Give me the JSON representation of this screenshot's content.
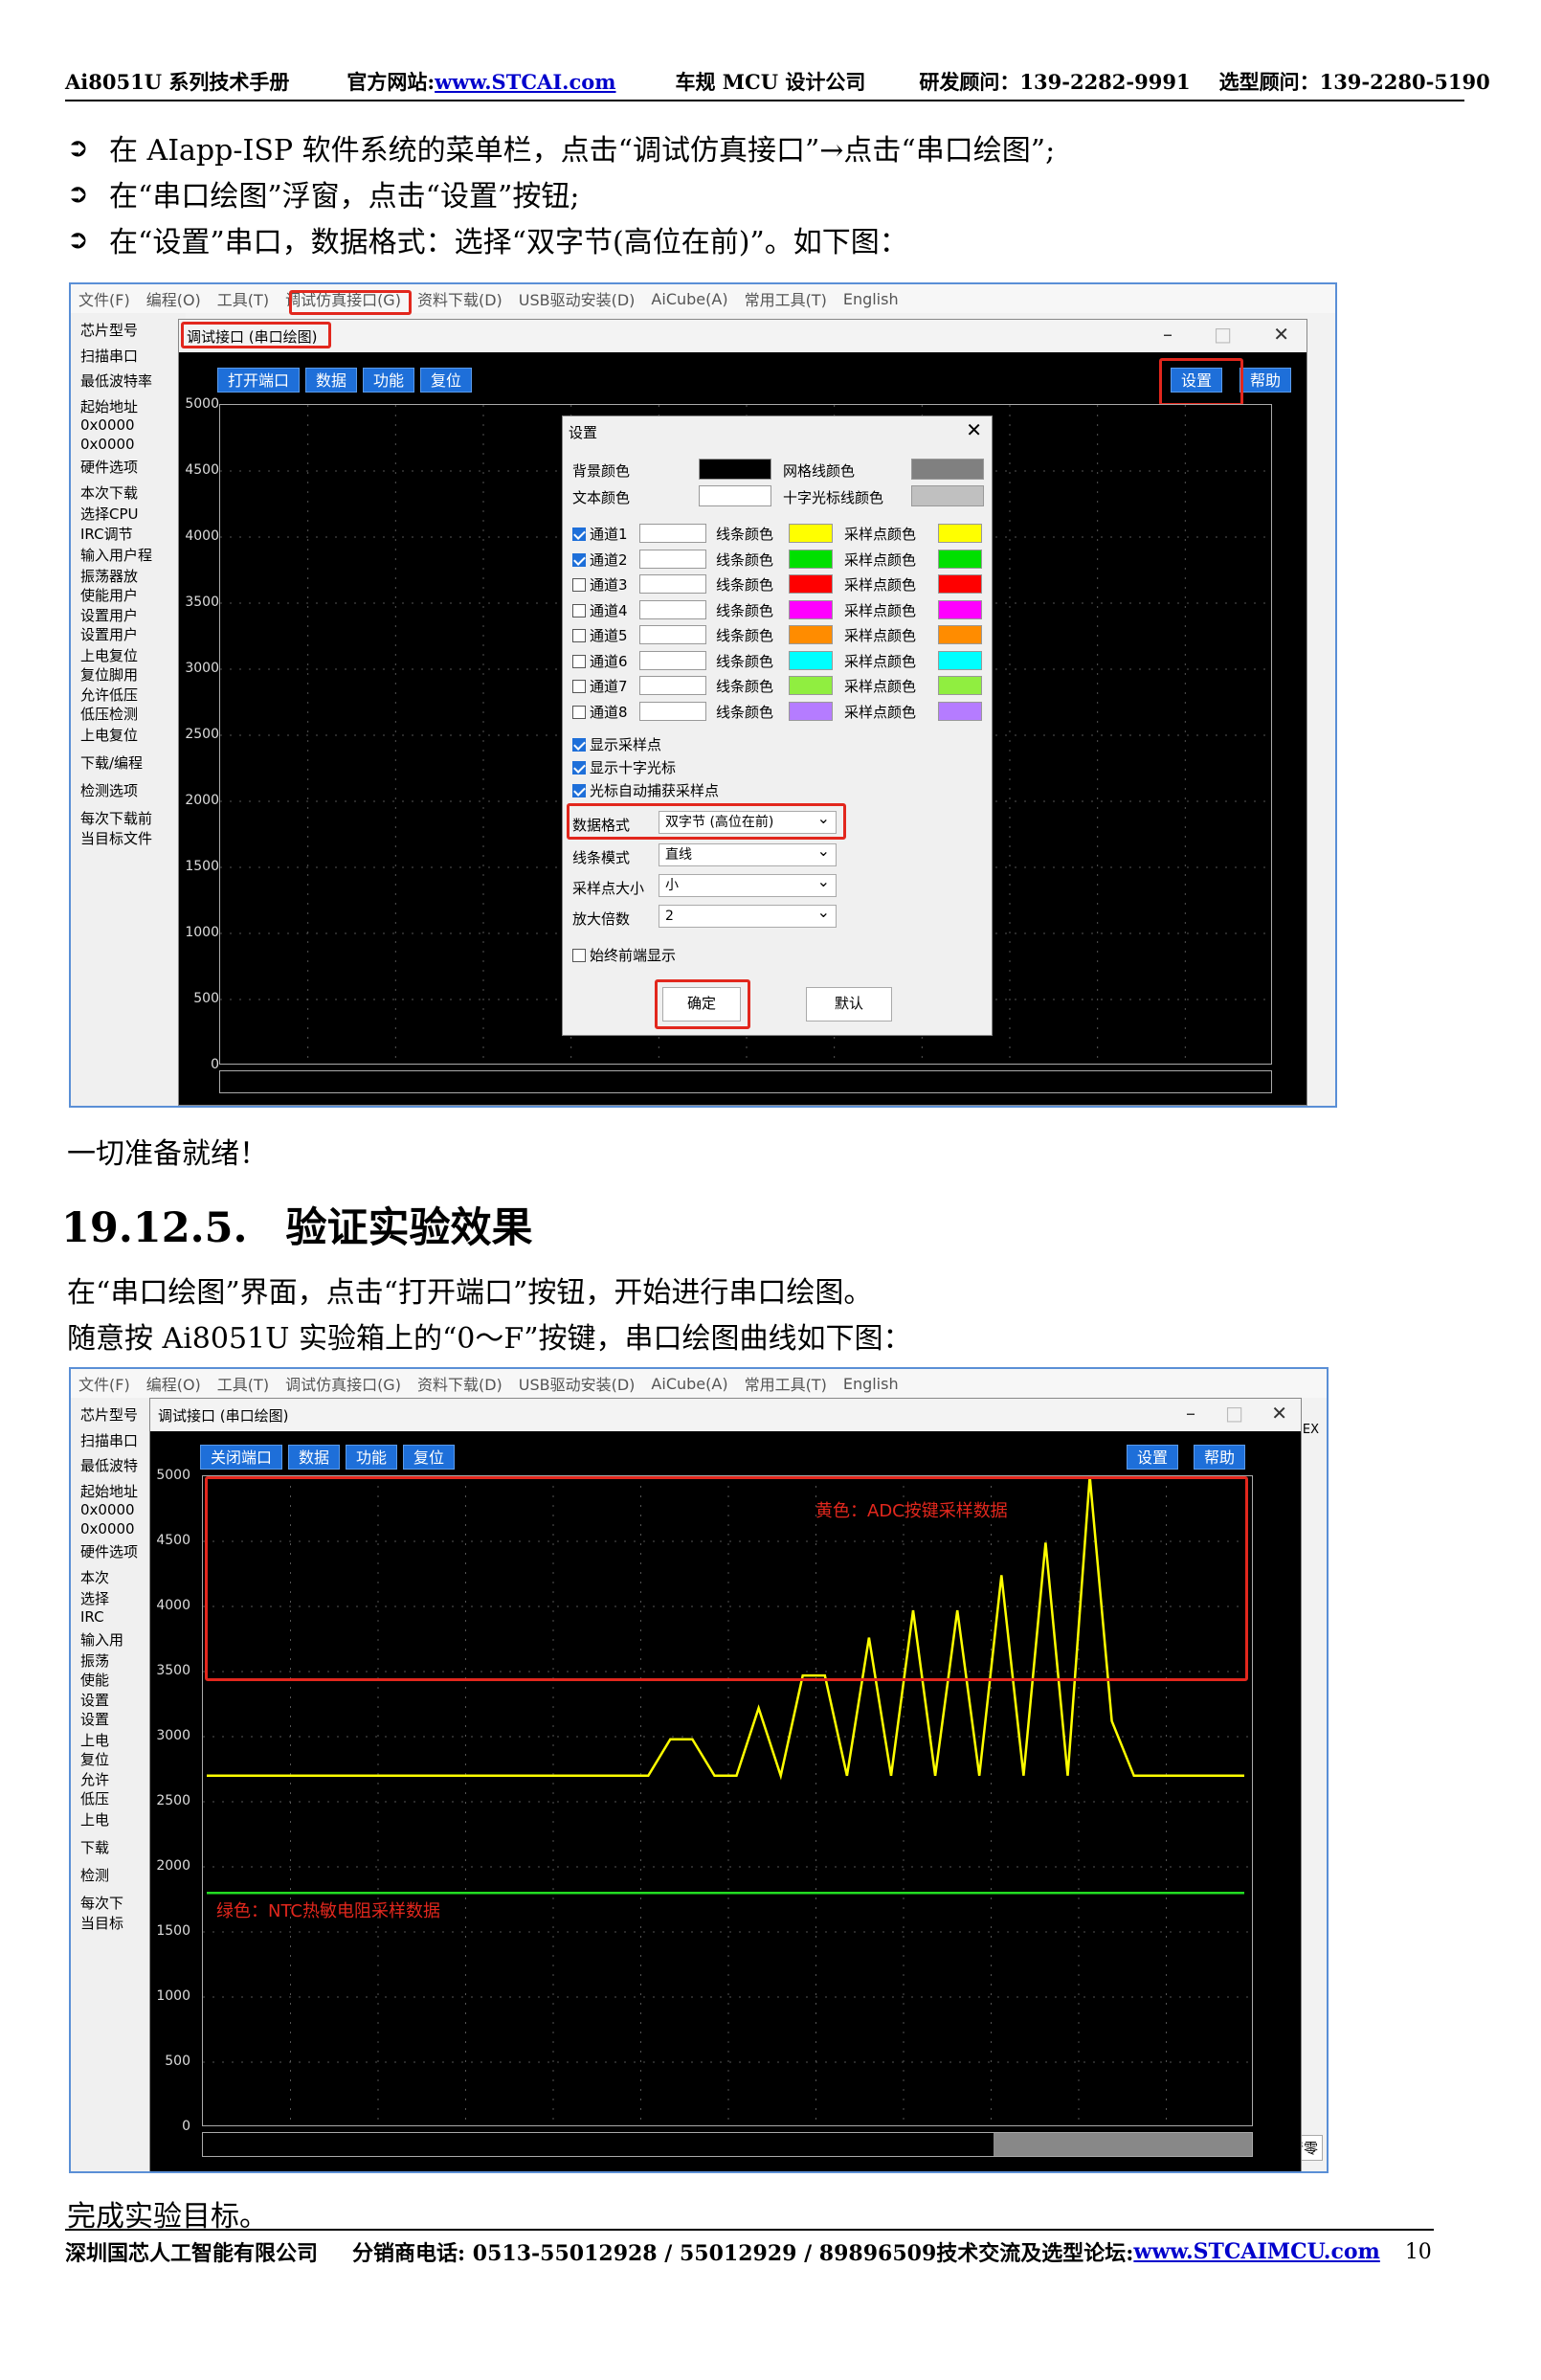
{
  "header": {
    "manual": "Ai8051U 系列技术手册",
    "site_label": "官方网站:",
    "site_url": "www.STCAI.com",
    "company": "车规 MCU 设计公司",
    "consult1": "研发顾问：139-2282-9991",
    "consult2": "选型顾问：139-2280-5190"
  },
  "bullets": [
    "在 AIapp-ISP 软件系统的菜单栏，点击“调试仿真接口”→点击“串口绘图”;",
    "在“串口绘图”浮窗，点击“设置”按钮;",
    "在“设置”串口，数据格式：选择“双字节(高位在前)”。如下图："
  ],
  "ready": "一切准备就绪！",
  "section": {
    "number": "19.12.5.",
    "title": "验证实验效果"
  },
  "para1": "在“串口绘图”界面，点击“打开端口”按钮，开始进行串口绘图。",
  "para2": "随意按 Ai8051U 实验箱上的“0～F”按键，串口绘图曲线如下图：",
  "done": "完成实验目标。",
  "footer": {
    "company": "深圳国芯人工智能有限公司",
    "phone": "分销商电话: 0513-55012928 / 55012929 / 89896509",
    "forum": "技术交流及选型论坛:",
    "forum_url": "www.STCAIMCU.com",
    "page": "10"
  },
  "menu": [
    "文件(F)",
    "编程(O)",
    "工具(T)",
    "调试仿真接口(G)",
    "资料下载(D)",
    "USB驱动安装(D)",
    "AiCube(A)",
    "常用工具(T)",
    "English"
  ],
  "left1": [
    "芯片型号",
    "扫描串口",
    "最低波特率",
    "起始地址",
    "0x0000",
    "0x0000",
    "硬件选项",
    "本次下载",
    "选择CPU",
    "IRC调节",
    "输入用户程",
    "振荡器放",
    "使能用户",
    "设置用户",
    "设置用户",
    "上电复位",
    "复位脚用",
    "允许低压",
    "低压检测",
    "上电复位",
    "下载/编程",
    "检测选项",
    "每次下载前",
    "当目标文件"
  ],
  "left2": [
    "芯片型号",
    "扫描串口",
    "最低波特",
    "起始地址",
    "0x0000",
    "0x0000",
    "硬件选项",
    "本次",
    "选择",
    "IRC",
    "输入用",
    "振荡",
    "使能",
    "设置",
    "设置",
    "上电",
    "复位",
    "允许",
    "低压",
    "上电",
    "下载",
    "检测",
    "每次下",
    "当目标"
  ],
  "win1": {
    "title": "调试接口 (串口绘图)",
    "buttons": [
      "打开端口",
      "数据",
      "功能",
      "复位"
    ],
    "settings": "设置",
    "help": "帮助"
  },
  "win2": {
    "title": "调试接口 (串口绘图)",
    "buttons": [
      "关闭端口",
      "数据",
      "功能",
      "复位"
    ],
    "settings": "设置",
    "help": "帮助",
    "clear": "清零",
    "hex": "EX"
  },
  "yticks": [
    "5000",
    "4500",
    "4000",
    "3500",
    "3000",
    "2500",
    "2000",
    "1500",
    "1000",
    "500",
    "0"
  ],
  "dialog": {
    "title": "设置",
    "bg": "背景颜色",
    "grid": "网格线颜色",
    "text": "文本颜色",
    "cross": "十字光标线颜色",
    "channels": [
      "通道1",
      "通道2",
      "通道3",
      "通道4",
      "通道5",
      "通道6",
      "通道7",
      "通道8"
    ],
    "line_color": "线条颜色",
    "sample_color": "采样点颜色",
    "channel_colors": [
      "#ffff00",
      "#00e000",
      "#ff0000",
      "#ff00ff",
      "#ff8c00",
      "#00ffff",
      "#90ee40",
      "#b57cff"
    ],
    "show_points": "显示采样点",
    "show_cross": "显示十字光标",
    "auto_capture": "光标自动捕获采样点",
    "format_label": "数据格式",
    "format_value": "双字节 (高位在前)",
    "line_mode_label": "线条模式",
    "line_mode_value": "直线",
    "point_size_label": "采样点大小",
    "point_size_value": "小",
    "zoom_label": "放大倍数",
    "zoom_value": "2",
    "front": "始终前端显示",
    "ok": "确定",
    "default": "默认"
  },
  "annotations": {
    "yellow": "黄色：ADC按键采样数据",
    "green": "绿色：NTC热敏电阻采样数据"
  },
  "chart_data": {
    "type": "line",
    "ylim": [
      0,
      5000
    ],
    "series": [
      {
        "name": "黄色：ADC按键采样数据",
        "color": "#ffff00",
        "x": [
          0,
          1,
          2,
          3,
          4,
          5,
          6,
          7,
          8,
          9,
          10,
          11,
          12,
          13,
          14,
          15,
          16,
          17,
          18,
          19,
          20,
          21,
          22,
          23,
          24,
          25,
          26,
          27,
          28,
          29,
          30,
          31,
          32,
          33,
          34,
          35,
          36,
          37,
          38,
          39,
          40,
          41,
          42,
          43,
          44,
          45,
          46,
          47
        ],
        "y": [
          2700,
          2700,
          2700,
          2700,
          2700,
          2700,
          2700,
          2700,
          2700,
          2700,
          2700,
          2700,
          2700,
          2700,
          2700,
          2700,
          2700,
          2700,
          2700,
          2700,
          2700,
          2980,
          2980,
          2700,
          2700,
          3220,
          2700,
          3470,
          3470,
          2700,
          3760,
          2700,
          3970,
          2700,
          3970,
          2700,
          4240,
          2700,
          4490,
          2700,
          5000,
          3120,
          2700,
          2700,
          2700,
          2700,
          2700,
          2700
        ]
      },
      {
        "name": "绿色：NTC热敏电阻采样数据",
        "color": "#22dd22",
        "x": [
          0,
          47
        ],
        "y": [
          1800,
          1800
        ]
      }
    ]
  }
}
